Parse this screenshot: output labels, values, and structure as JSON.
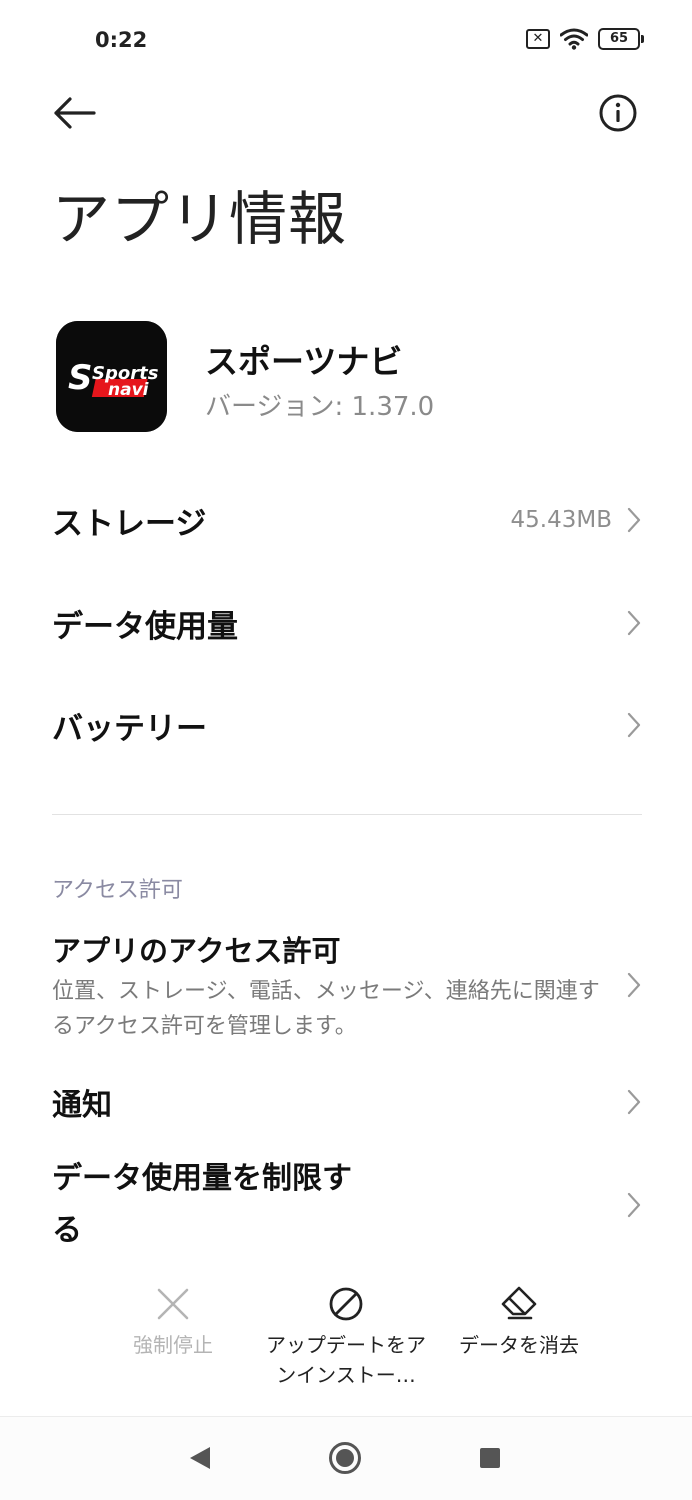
{
  "status_bar": {
    "time": "0:22",
    "battery": "65"
  },
  "header": {
    "title": "アプリ情報"
  },
  "app": {
    "name": "スポーツナビ",
    "version_label": "バージョン: ",
    "version": "1.37.0",
    "icon_text_top": "Sports",
    "icon_text_bottom": "navi"
  },
  "rows": {
    "storage": {
      "label": "ストレージ",
      "value": "45.43MB"
    },
    "data_usage": {
      "label": "データ使用量"
    },
    "battery": {
      "label": "バッテリー"
    }
  },
  "permissions_section": {
    "header": "アクセス許可",
    "app_permissions": {
      "title": "アプリのアクセス許可",
      "description": "位置、ストレージ、電話、メッセージ、連絡先に関連するアクセス許可を管理します。"
    },
    "notifications": {
      "label": "通知"
    },
    "limit_data": {
      "label": "データ使用量を制限する"
    }
  },
  "actions": {
    "force_stop": "強制停止",
    "uninstall_updates": "アップデートをアンインストー…",
    "clear_data": "データを消去"
  },
  "colors": {
    "icon_bg": "#0b0b0b",
    "icon_red": "#e6161c",
    "disabled": "#b4b4b4",
    "muted": "#8a8a8a"
  }
}
